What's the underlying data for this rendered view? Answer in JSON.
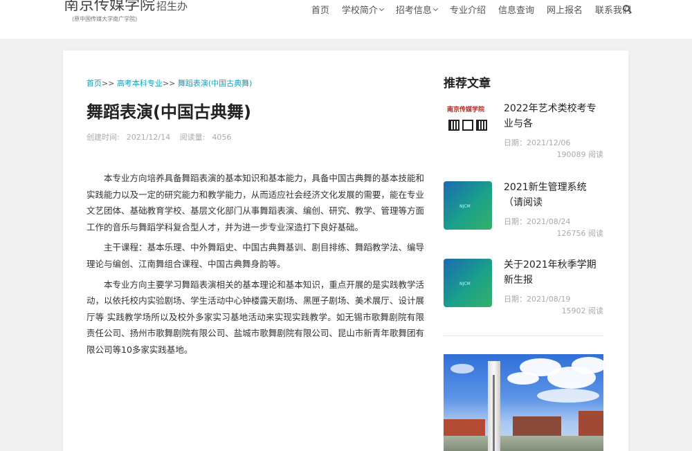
{
  "header": {
    "logo_main": "南京传媒学院",
    "logo_suffix": "招生办",
    "logo_sub": "(原中国传媒大学南广学院)",
    "nav": [
      {
        "label": "首页",
        "has_dropdown": false
      },
      {
        "label": "学校简介",
        "has_dropdown": true
      },
      {
        "label": "招考信息",
        "has_dropdown": true
      },
      {
        "label": "专业介绍",
        "has_dropdown": false
      },
      {
        "label": "信息查询",
        "has_dropdown": false
      },
      {
        "label": "网上报名",
        "has_dropdown": false
      },
      {
        "label": "联系我们",
        "has_dropdown": false
      }
    ],
    "search_icon": "search-icon"
  },
  "article": {
    "breadcrumb": [
      {
        "label": "首页"
      },
      {
        "label": "高考本科专业"
      },
      {
        "label": "舞蹈表演(中国古典舞)"
      }
    ],
    "breadcrumb_sep": ">>",
    "title": "舞蹈表演(中国古典舞)",
    "created_label": "创建时间:",
    "created_value": "2021/12/14",
    "views_label": "阅读量:",
    "views_value": "4056",
    "paragraphs": [
      "本专业方向培养具备舞蹈表演的基本知识和基本能力，具备中国古典舞的基本技能和实践能力以及一定的研究能力和教学能力，从而适应社会经济文化发展的需要，能在专业文艺团体、基础教育学校、基层文化部门从事舞蹈表演、编创、研究、教学、管理等方面工作的音乐与舞蹈学科复合型人才，并为进一步专业深造打下良好基础。",
      "主干课程：基本乐理、中外舞蹈史、中国古典舞基训、剧目排练、舞蹈教学法、编导理论与编创、江南舞组合课程、中国古典舞身韵等。",
      "本专业方向主要学习舞蹈表演相关的基本理论和基本知识，重点开展的是实践教学活动，以依托校内实验剧场、学生活动中心钟楼露天剧场、黑匣子剧场、美术展厅、设计展厅等 实践教学场所以及校外多家实习基地活动来实现实践教学。如无锡市歌舞剧院有限责任公司、扬州市歌舞剧院有限公司、盐城市歌舞剧院有限公司、昆山市新青年歌舞团有限公司等10多家实践基地。"
    ]
  },
  "sidebar": {
    "title": "推荐文章",
    "items": [
      {
        "title": "2022年艺术类校考专业与各",
        "date_label": "日期：",
        "date": "2021/12/06",
        "reads": "190089",
        "reads_suffix": "阅读",
        "thumb": "qr-poster",
        "thumb_text": "南京传媒学院"
      },
      {
        "title": "2021新生管理系统（请阅读",
        "date_label": "日期：",
        "date": "2021/08/24",
        "reads": "126756",
        "reads_suffix": "阅读",
        "thumb": "green-gradient",
        "thumb_text": "NJCM"
      },
      {
        "title": "关于2021年秋季学期新生报",
        "date_label": "日期：",
        "date": "2021/08/19",
        "reads": "15902",
        "reads_suffix": "阅读",
        "thumb": "green-gradient",
        "thumb_text": "NJCM"
      }
    ],
    "photo": "campus-photo"
  },
  "colors": {
    "link": "#1aa0b8",
    "background": "#f1f1f1",
    "card": "#ffffff"
  }
}
